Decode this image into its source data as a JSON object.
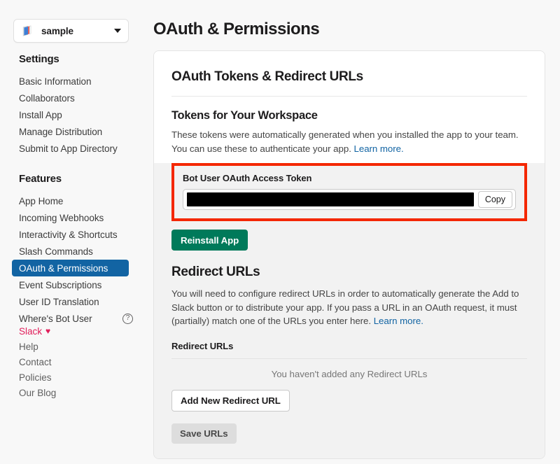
{
  "sidebar": {
    "workspace": {
      "name": "sample",
      "icon": "app-stack-icon",
      "caret": "chevron-down-icon"
    },
    "groups": [
      {
        "heading": "Settings",
        "items": [
          {
            "label": "Basic Information",
            "active": false
          },
          {
            "label": "Collaborators",
            "active": false
          },
          {
            "label": "Install App",
            "active": false
          },
          {
            "label": "Manage Distribution",
            "active": false
          },
          {
            "label": "Submit to App Directory",
            "active": false
          }
        ]
      },
      {
        "heading": "Features",
        "items": [
          {
            "label": "App Home",
            "active": false
          },
          {
            "label": "Incoming Webhooks",
            "active": false
          },
          {
            "label": "Interactivity & Shortcuts",
            "active": false
          },
          {
            "label": "Slash Commands",
            "active": false
          },
          {
            "label": "OAuth & Permissions",
            "active": true
          },
          {
            "label": "Event Subscriptions",
            "active": false
          },
          {
            "label": "User ID Translation",
            "active": false
          },
          {
            "label": "Where's Bot User",
            "active": false,
            "help_icon": "question-mark-circle-icon"
          }
        ]
      }
    ],
    "footer": [
      {
        "label": "Slack",
        "brand": true,
        "heart": "♥"
      },
      {
        "label": "Help",
        "brand": false
      },
      {
        "label": "Contact",
        "brand": false
      },
      {
        "label": "Policies",
        "brand": false
      },
      {
        "label": "Our Blog",
        "brand": false
      }
    ]
  },
  "main": {
    "page_title": "OAuth & Permissions",
    "card_title": "OAuth Tokens & Redirect URLs",
    "tokens": {
      "heading": "Tokens for Your Workspace",
      "description_line1": "These tokens were automatically generated when you installed the app to your team.",
      "description_line2": "You can use these to authenticate your app. ",
      "learn_more": "Learn more.",
      "field_label": "Bot User OAuth Access Token",
      "token_value": "",
      "token_redacted": true,
      "copy_label": "Copy",
      "reinstall_label": "Reinstall App"
    },
    "redirect": {
      "heading": "Redirect URLs",
      "description": "You will need to configure redirect URLs in order to automatically generate the Add to Slack button or to distribute your app. If you pass a URL in an OAuth request, it must (partially) match one of the URLs you enter here. ",
      "learn_more": "Learn more.",
      "subheading": "Redirect URLs",
      "empty_message": "You haven't added any Redirect URLs",
      "add_label": "Add New Redirect URL",
      "save_label": "Save URLs"
    }
  },
  "colors": {
    "accent_blue": "#1264A3",
    "brand_red": "#E01E5A",
    "green": "#007A5A",
    "highlight_red": "#F42700",
    "page_bg": "#F8F8F8",
    "card_grey": "#F2F2F2"
  }
}
